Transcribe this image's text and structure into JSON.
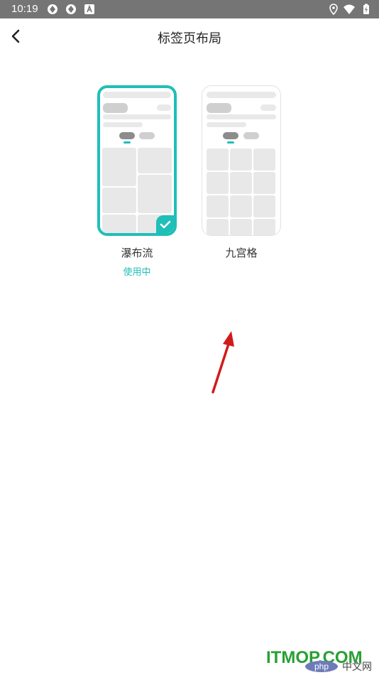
{
  "status_bar": {
    "time": "10:19"
  },
  "header": {
    "title": "标签页布局"
  },
  "options": [
    {
      "label": "瀑布流",
      "status": "使用中",
      "selected": true
    },
    {
      "label": "九宫格",
      "status": "",
      "selected": false
    }
  ],
  "watermark": {
    "text": "ITMOP.COM",
    "php": "php",
    "cn": "中文网"
  },
  "colors": {
    "accent": "#1fbfb8",
    "statusbar": "#757575",
    "arrow": "#d11a1a",
    "watermark": "#28a034"
  }
}
